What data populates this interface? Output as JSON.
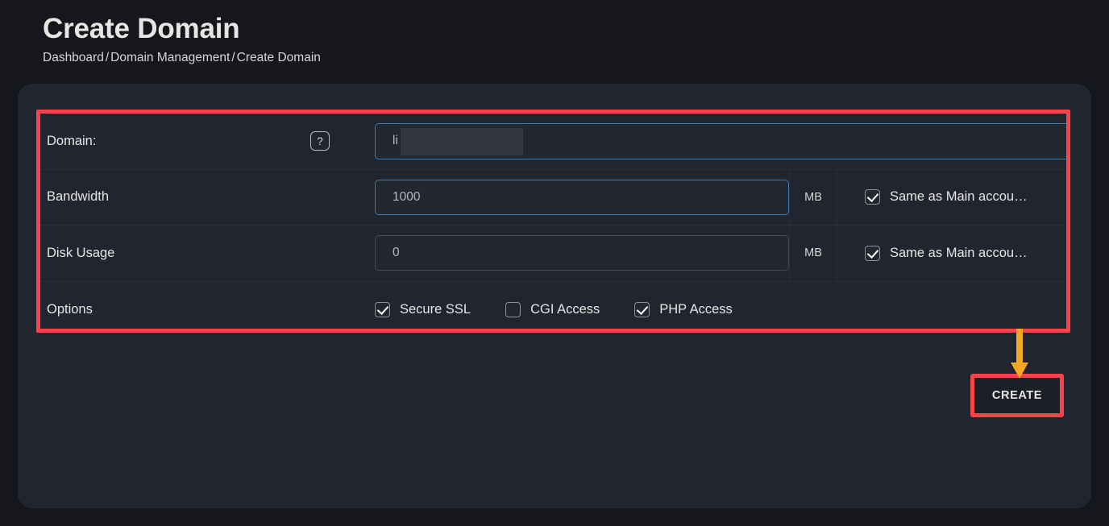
{
  "header": {
    "title": "Create Domain",
    "breadcrumb": {
      "items": [
        "Dashboard",
        "Domain Management",
        "Create Domain"
      ],
      "separator": "/"
    }
  },
  "form": {
    "rows": {
      "domain": {
        "label": "Domain:",
        "help_icon": "?",
        "value": "li",
        "focused": true,
        "redacted": true
      },
      "bandwidth": {
        "label": "Bandwidth",
        "value": "1000",
        "unit": "MB",
        "same_as_main_label": "Same as Main accou…",
        "same_as_main_checked": true,
        "focused": true
      },
      "disk_usage": {
        "label": "Disk Usage",
        "value": "0",
        "unit": "MB",
        "same_as_main_label": "Same as Main accou…",
        "same_as_main_checked": true,
        "focused": false
      },
      "options": {
        "label": "Options",
        "items": [
          {
            "label": "Secure SSL",
            "checked": true
          },
          {
            "label": "CGI Access",
            "checked": false
          },
          {
            "label": "PHP Access",
            "checked": true
          }
        ]
      }
    }
  },
  "actions": {
    "create_label": "CREATE"
  },
  "annotations": {
    "highlight_color": "#f6444a",
    "arrow_color": "#f5a623"
  },
  "colors": {
    "page_background": "#15171d",
    "panel_background": "#212530",
    "field_background": "#23272f",
    "text_primary": "#e8e6e3",
    "focus_border": "#3f7bb5"
  }
}
